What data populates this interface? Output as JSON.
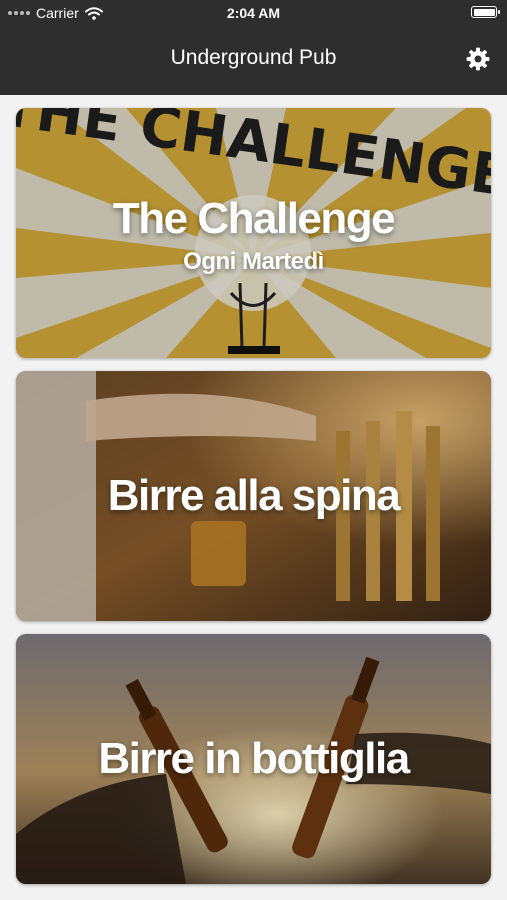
{
  "status_bar": {
    "carrier": "Carrier",
    "time": "2:04 AM"
  },
  "nav": {
    "title": "Underground Pub",
    "settings_icon": "gear-icon"
  },
  "cards": [
    {
      "title": "The Challenge",
      "subtitle": "Ogni Martedì",
      "banner_text": "THE CHALLENGE"
    },
    {
      "title": "Birre alla spina"
    },
    {
      "title": "Birre in bottiglia"
    }
  ],
  "colors": {
    "nav_bg": "#2e2e2e",
    "background": "#f2f2f2",
    "challenge_yellow": "#d9ae2e"
  }
}
